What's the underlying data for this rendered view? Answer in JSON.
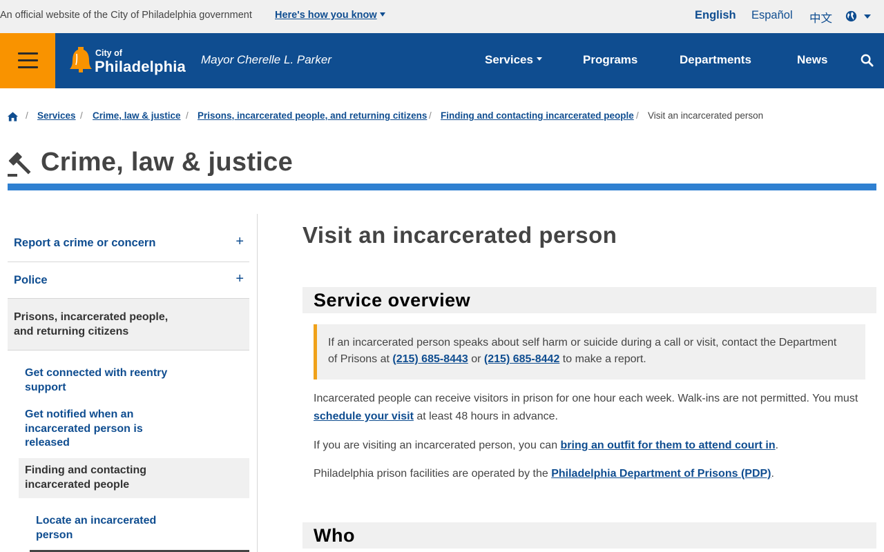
{
  "banner": {
    "official_text": "An official website of the City of Philadelphia government",
    "how_you_know": "Here's how you know",
    "languages": [
      "English",
      "Español",
      "中文"
    ]
  },
  "header": {
    "logo_city_of": "City of",
    "logo_name": "Philadelphia",
    "mayor": "Mayor Cherelle L. Parker",
    "nav": [
      "Services",
      "Programs",
      "Departments",
      "News"
    ]
  },
  "breadcrumb": {
    "items": [
      "Services",
      "Crime, law & justice",
      "Prisons, incarcerated people, and returning citizens",
      "Finding and contacting incarcerated people"
    ],
    "current": "Visit an incarcerated person"
  },
  "section_title": "Crime, law & justice",
  "sidenav": {
    "items": [
      "Report a crime or concern",
      "Police",
      "Prisons, incarcerated people, and returning citizens",
      "Get connected with reentry support",
      "Get notified when an incarcerated person is released",
      "Finding and contacting incarcerated people",
      "Locate an incarcerated person"
    ]
  },
  "main": {
    "title": "Visit an incarcerated person",
    "overview_heading": "Service overview",
    "callout": {
      "text_before": "If an incarcerated person speaks about self harm or suicide during a call or visit, contact the Department of Prisons at ",
      "phone1": "(215) 685-8443",
      "middle": " or ",
      "phone2": "(215) 685-8442",
      "text_after": " to make a report."
    },
    "para1": {
      "before": "Incarcerated people can receive visitors in prison for one hour each week. Walk-ins are not permitted. You must ",
      "link": "schedule your visit",
      "after": " at least 48 hours in advance."
    },
    "para2": {
      "before": "If you are visiting an incarcerated person, you can ",
      "link": "bring an outfit for them to attend court in",
      "after": "."
    },
    "para3": {
      "before": "Philadelphia prison facilities are operated by the ",
      "link": "Philadelphia Department of Prisons (PDP)",
      "after": "."
    },
    "who_heading": "Who"
  },
  "colors": {
    "header_blue": "#0f4d90",
    "menu_orange": "#f99300",
    "accent_rule": "#2f80d1",
    "callout_border": "#f0a21a",
    "band_gray": "#f0f0f0"
  },
  "icons": [
    "menu-icon",
    "liberty-bell-logo",
    "globe-icon",
    "search-icon",
    "home-icon",
    "gavel-icon",
    "plus-icon"
  ]
}
